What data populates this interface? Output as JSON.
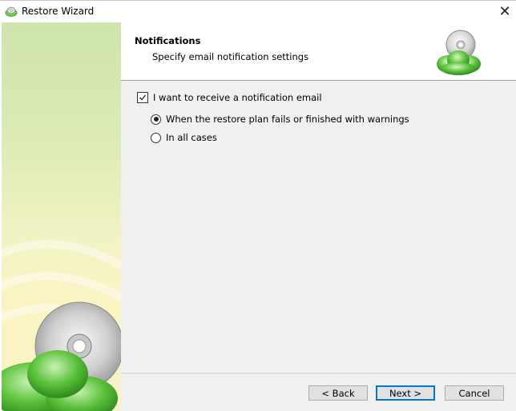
{
  "window": {
    "title": "Restore Wizard"
  },
  "header": {
    "title": "Notifications",
    "subtitle": "Specify email notification settings"
  },
  "options": {
    "receive_email_label": "I want to receive a notification email",
    "receive_email_checked": true,
    "radio_fail_label": "When the restore plan fails or finished with warnings",
    "radio_all_label": "In all cases",
    "selected_radio": "fail"
  },
  "buttons": {
    "back_label": "< Back",
    "next_label": "Next >",
    "cancel_label": "Cancel"
  },
  "icons": {
    "title": "cloud-cd-icon",
    "header": "cloud-cd-icon",
    "close": "close-icon"
  },
  "colors": {
    "accent": "#0078d7",
    "brand_green": "#5cc23c"
  }
}
